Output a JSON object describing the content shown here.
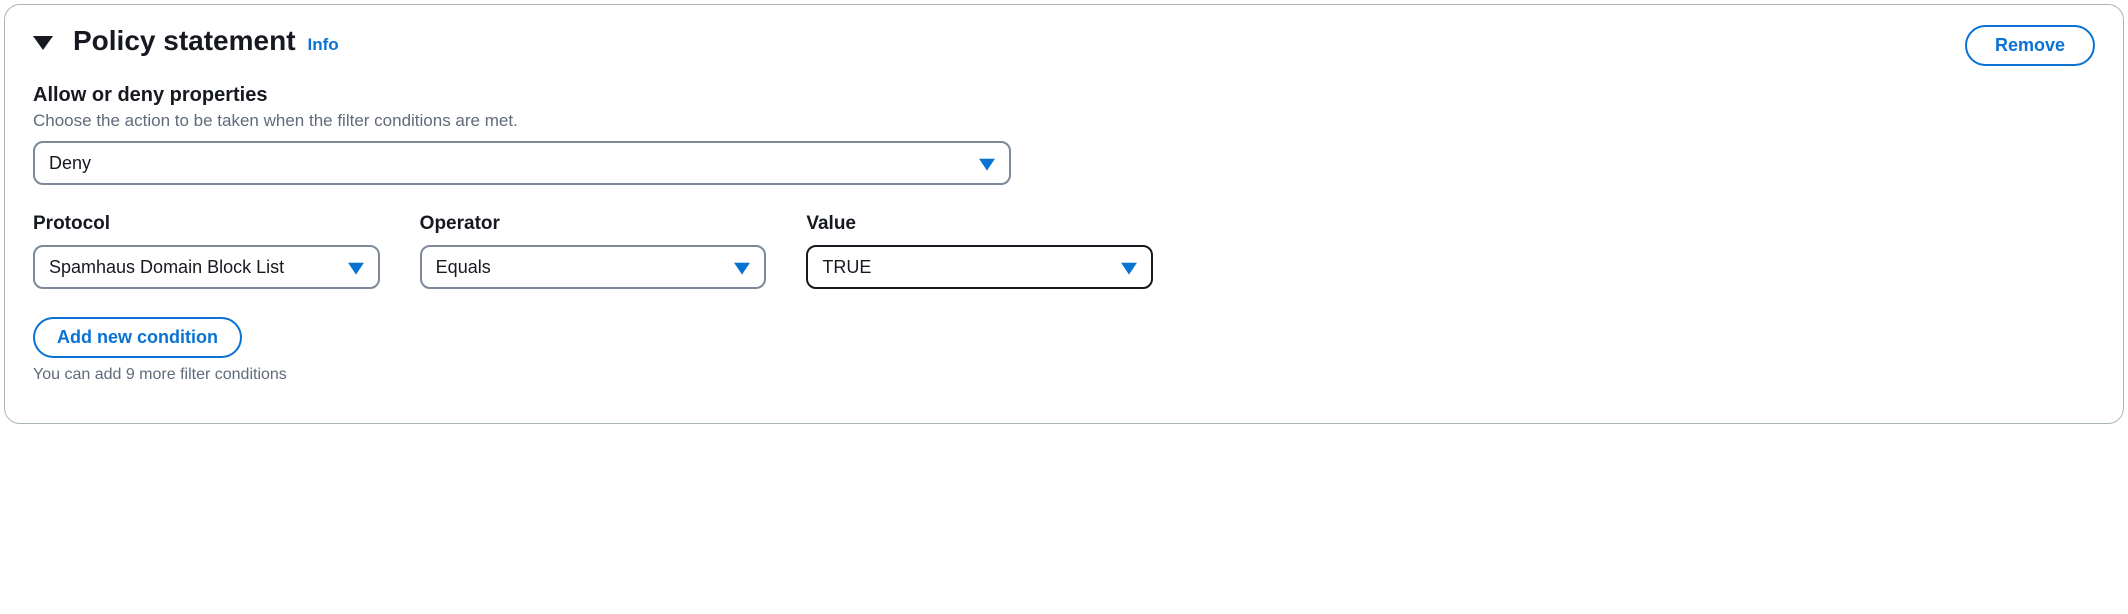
{
  "header": {
    "title": "Policy statement",
    "info_label": "Info",
    "remove_label": "Remove"
  },
  "allow_deny": {
    "label": "Allow or deny properties",
    "description": "Choose the action to be taken when the filter conditions are met.",
    "value": "Deny"
  },
  "condition": {
    "protocol_label": "Protocol",
    "protocol_value": "Spamhaus Domain Block List",
    "operator_label": "Operator",
    "operator_value": "Equals",
    "value_label": "Value",
    "value_value": "TRUE"
  },
  "add": {
    "button_label": "Add new condition",
    "hint": "You can add 9 more filter conditions"
  }
}
